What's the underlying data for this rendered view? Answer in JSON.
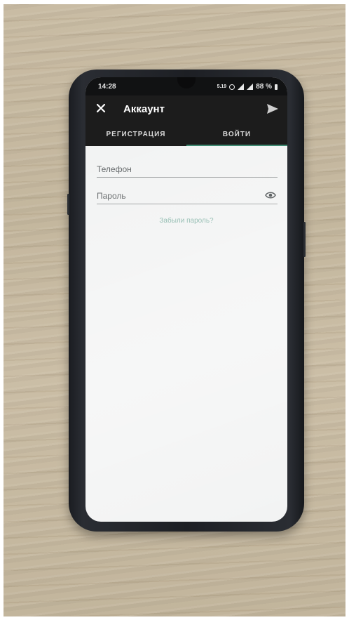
{
  "status": {
    "time": "14:28",
    "data_rate": "5.19",
    "battery": "88 %"
  },
  "appbar": {
    "title": "Аккаунт",
    "close_icon": "close-icon",
    "send_icon": "send-icon"
  },
  "tabs": [
    {
      "label": "РЕГИСТРАЦИЯ",
      "active": false
    },
    {
      "label": "ВОЙТИ",
      "active": true
    }
  ],
  "form": {
    "phone_label": "Телефон",
    "password_label": "Пароль",
    "password_visibility_icon": "eye-icon",
    "forgot_password": "Забыли пароль?"
  },
  "colors": {
    "appbar_bg": "#1c1c1c",
    "tab_indicator": "#3f8a72",
    "link": "#86b5a8",
    "screen_bg": "#f2f3f3"
  }
}
